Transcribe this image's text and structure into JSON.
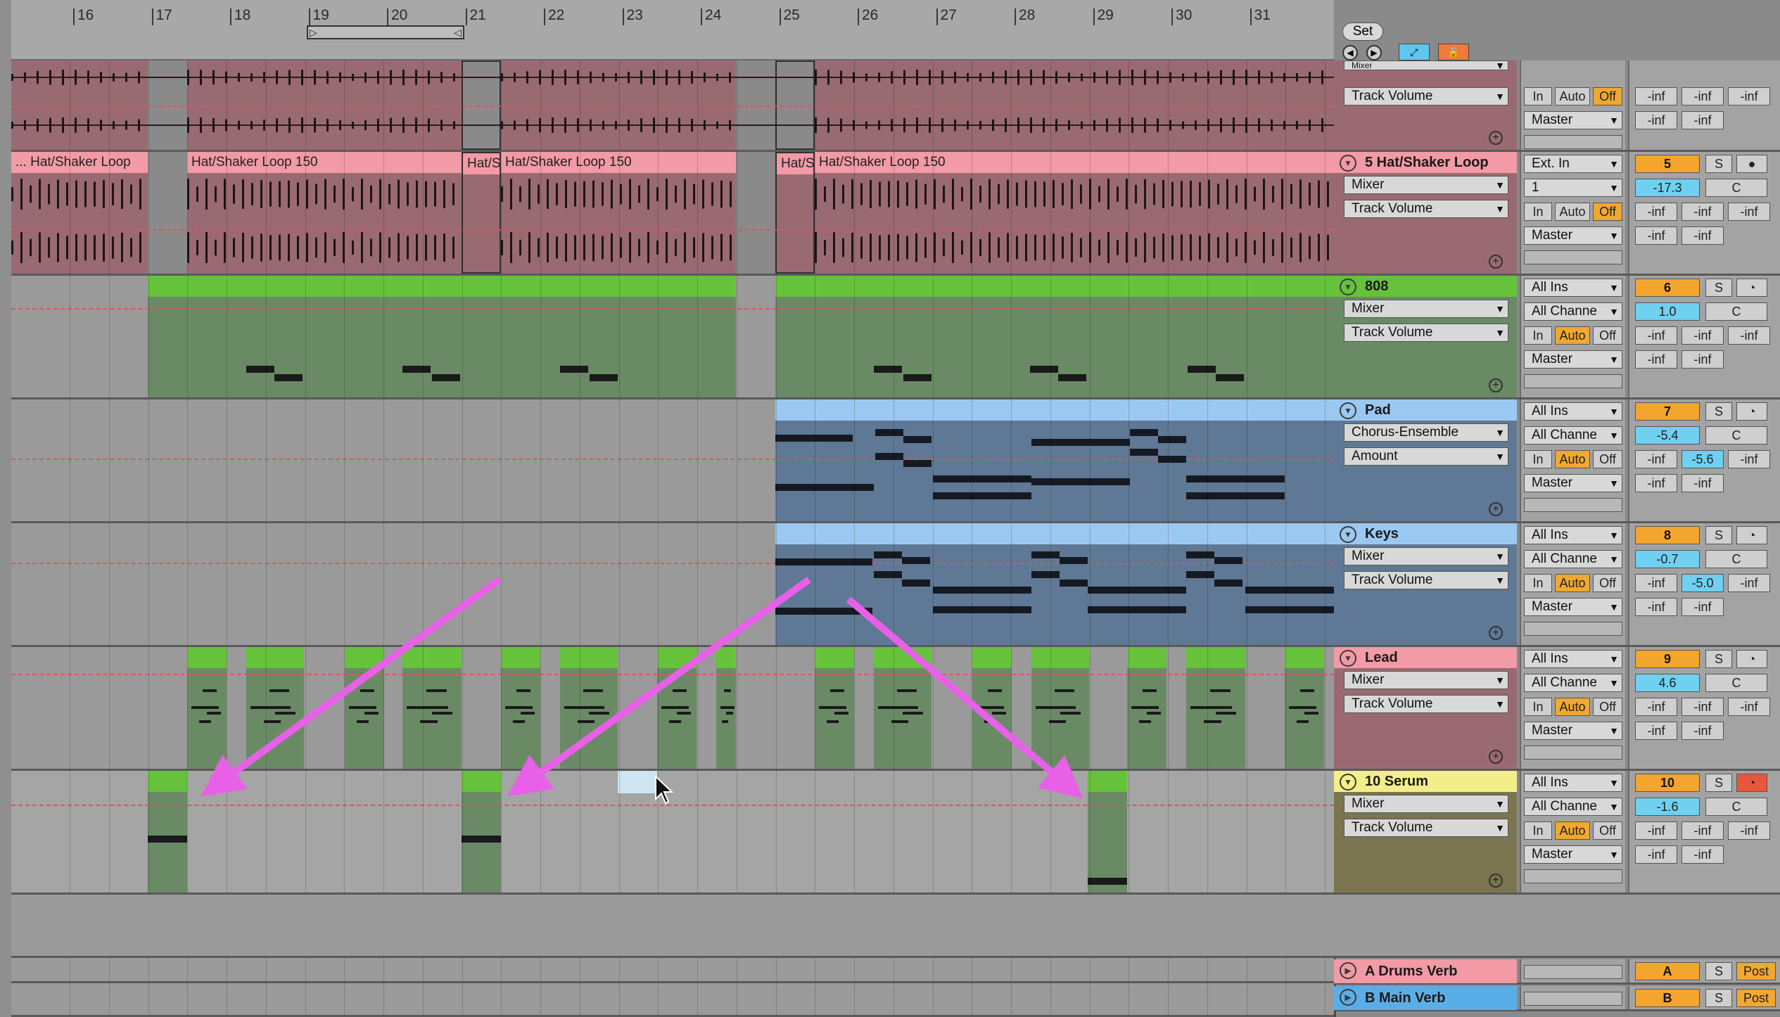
{
  "ruler": {
    "bars": [
      "16",
      "17",
      "18",
      "19",
      "20",
      "21",
      "22",
      "23",
      "24",
      "25",
      "26",
      "27",
      "28",
      "29",
      "30",
      "31"
    ]
  },
  "controls": {
    "set_label": "Set"
  },
  "tracks": [
    {
      "name": "",
      "clips": [],
      "io": {
        "device_top": "Mixer",
        "param": "Track Volume",
        "in_btn": "In",
        "auto_btn": "Auto",
        "off_btn": "Off",
        "output": "Master"
      },
      "vals": [
        "-inf",
        "-inf",
        "-inf",
        "-inf",
        "-inf"
      ]
    },
    {
      "name": "5 Hat/Shaker Loop",
      "clip_labels": [
        "... Hat/Shaker Loop",
        "Hat/Shaker Loop 150",
        "Hat/S",
        "Hat/Shaker Loop 150",
        "Hat/S",
        "Hat/Shaker Loop 150"
      ],
      "input": "Ext. In",
      "channel": "1",
      "device": "Mixer",
      "param": "Track Volume",
      "in_btn": "In",
      "auto_btn": "Auto",
      "off_btn": "Off",
      "output": "Master",
      "number": "5",
      "volume": "-17.3",
      "pan": "C",
      "solo": "S",
      "vals": [
        "-inf",
        "-inf",
        "-inf",
        "-inf",
        "-inf"
      ]
    },
    {
      "name": "808",
      "input": "All Ins",
      "channel": "All Channe",
      "device": "Mixer",
      "param": "Track Volume",
      "in_btn": "In",
      "auto_btn": "Auto",
      "off_btn": "Off",
      "output": "Master",
      "number": "6",
      "volume": "1.0",
      "pan": "C",
      "solo": "S",
      "vals": [
        "-inf",
        "-inf",
        "-inf",
        "-inf",
        "-inf"
      ]
    },
    {
      "name": "Pad",
      "input": "All Ins",
      "channel": "All Channe",
      "device": "Chorus-Ensemble",
      "param": "Amount",
      "in_btn": "In",
      "auto_btn": "Auto",
      "off_btn": "Off",
      "output": "Master",
      "number": "7",
      "volume": "-5.4",
      "pan": "C",
      "solo": "S",
      "vals": [
        "-inf",
        "-5.6",
        "-inf",
        "-inf",
        "-inf"
      ]
    },
    {
      "name": "Keys",
      "input": "All Ins",
      "channel": "All Channe",
      "device": "Mixer",
      "param": "Track Volume",
      "in_btn": "In",
      "auto_btn": "Auto",
      "off_btn": "Off",
      "output": "Master",
      "number": "8",
      "volume": "-0.7",
      "pan": "C",
      "solo": "S",
      "vals": [
        "-inf",
        "-5.0",
        "-inf",
        "-inf",
        "-inf"
      ]
    },
    {
      "name": "Lead",
      "input": "All Ins",
      "channel": "All Channe",
      "device": "Mixer",
      "param": "Track Volume",
      "in_btn": "In",
      "auto_btn": "Auto",
      "off_btn": "Off",
      "output": "Master",
      "number": "9",
      "volume": "4.6",
      "pan": "C",
      "solo": "S",
      "vals": [
        "-inf",
        "-inf",
        "-inf",
        "-inf",
        "-inf"
      ]
    },
    {
      "name": "10 Serum",
      "input": "All Ins",
      "channel": "All Channe",
      "device": "Mixer",
      "param": "Track Volume",
      "in_btn": "In",
      "auto_btn": "Auto",
      "off_btn": "Off",
      "output": "Master",
      "number": "10",
      "volume": "-1.6",
      "pan": "C",
      "solo": "S",
      "vals": [
        "-inf",
        "-inf",
        "-inf",
        "-inf",
        "-inf"
      ]
    }
  ],
  "returns": [
    {
      "name": "A Drums Verb",
      "letter": "A",
      "solo": "S",
      "post": "Post",
      "color": "#f29aa6"
    },
    {
      "name": "B Main Verb",
      "letter": "B",
      "solo": "S",
      "post": "Post",
      "color": "#5aaee8"
    }
  ],
  "colors": {
    "hat": "#f29aa6",
    "hat_body": "#9a6a72",
    "green": "#66c23a",
    "green_body": "#6a8a66",
    "blue": "#9ac8f0",
    "blue_body": "#5f7896",
    "serum": "#f4ee88",
    "serum_body": "#7a7550",
    "arrow": "#e860e8",
    "lead_hdr": "#f29aa6"
  }
}
